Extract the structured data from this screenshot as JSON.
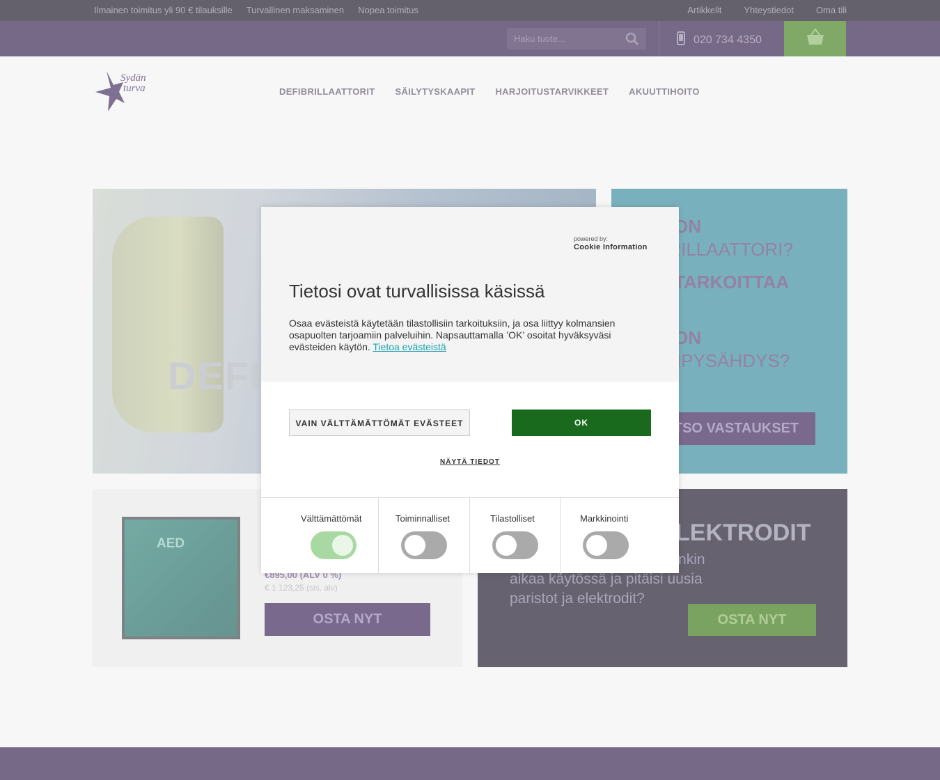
{
  "topbar": {
    "free_shipping": "Ilmainen toimitus yli 90 € tilauksille",
    "secure_payment": "Turvallinen maksaminen",
    "fast_delivery": "Nopea toimitus",
    "articles": "Artikkelit",
    "contact": "Yhteystiedot",
    "account": "Oma tili"
  },
  "header": {
    "search_placeholder": "Haku tuote...",
    "phone": "020 734 4350"
  },
  "nav": {
    "items": [
      "DEFIBRILLAATTORIT",
      "SÄILYTYSKAAPIT",
      "HARJOITUSTARVIKKEET",
      "AKUUTTIHOITO"
    ]
  },
  "logo": {
    "line1": "Sydän",
    "line2": "turva"
  },
  "banner_left": {
    "text": "DEFI"
  },
  "banner_right": {
    "q1": "Ä ON",
    "q1b": "BRILLAATTORI?",
    "q2": "Ä TARKOITTAA",
    "q3": "Ä ON",
    "q3b": "ÄNPYSÄHDYS?",
    "button": "TSO VASTAUKSET"
  },
  "product": {
    "price": "€895,00 (ALV 0 %)",
    "price_vat": "€ 1 123,25 (sis. alv)",
    "badge": "AED",
    "buy": "OSTA NYT"
  },
  "electrodes": {
    "title": "LEKTRODIT",
    "line1": "t jonkin",
    "line2": "aikaa käytössä ja pitäisi uusia",
    "line3": "paristot ja elektrodit?",
    "buy": "OSTA NYT"
  },
  "cookie": {
    "powered_by": "powered by:",
    "provider": "Cookie Information",
    "title": "Tietosi ovat turvallisissa käsissä",
    "body": "Osaa evästeistä käytetään tilastollisiin tarkoituksiin, ja osa liittyy kolmansien osapuolten tarjoamiin palveluihin. Napsauttamalla ’OK’ osoitat hyväksyväsi evästeiden käytön.",
    "link": "Tietoa evästeistä",
    "necessary_button": "VAIN VÄLTTÄMÄTTÖMÄT EVÄSTEET",
    "ok_button": "OK",
    "show_details": "NÄYTÄ TIEDOT",
    "categories": [
      {
        "label": "Välttämättömät",
        "enabled": true
      },
      {
        "label": "Toiminnalliset",
        "enabled": false
      },
      {
        "label": "Tilastolliset",
        "enabled": false
      },
      {
        "label": "Markkinointi",
        "enabled": false
      }
    ]
  },
  "colors": {
    "brand_purple": "#2d1949",
    "ok_green": "#1a6a1e",
    "link_teal": "#1aa0b3"
  }
}
